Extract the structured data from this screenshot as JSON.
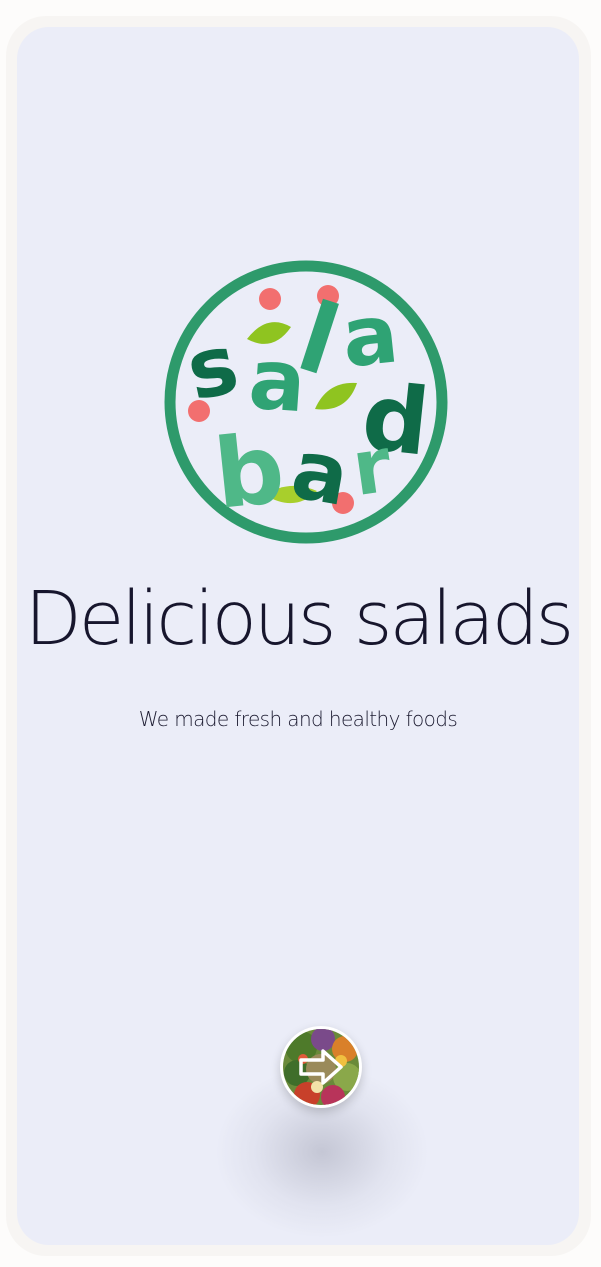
{
  "logo": {
    "letters": [
      "s",
      "a",
      "l",
      "a",
      "d",
      "b",
      "a",
      "r"
    ],
    "colors": {
      "ring": "#2e9a6b",
      "dark_green": "#0f6b48",
      "mid_green": "#2fa374",
      "light_green": "#4fb888",
      "leaf": "#8fc420",
      "dot": "#f26f6f"
    }
  },
  "headline": "Delicious salads",
  "subtitle": "We made fresh and healthy foods",
  "next_button": {
    "icon": "arrow-right-icon",
    "background": "salad-bowl-photo"
  },
  "theme": {
    "screen_bg": "#ebedf8",
    "text": "#17162d"
  }
}
